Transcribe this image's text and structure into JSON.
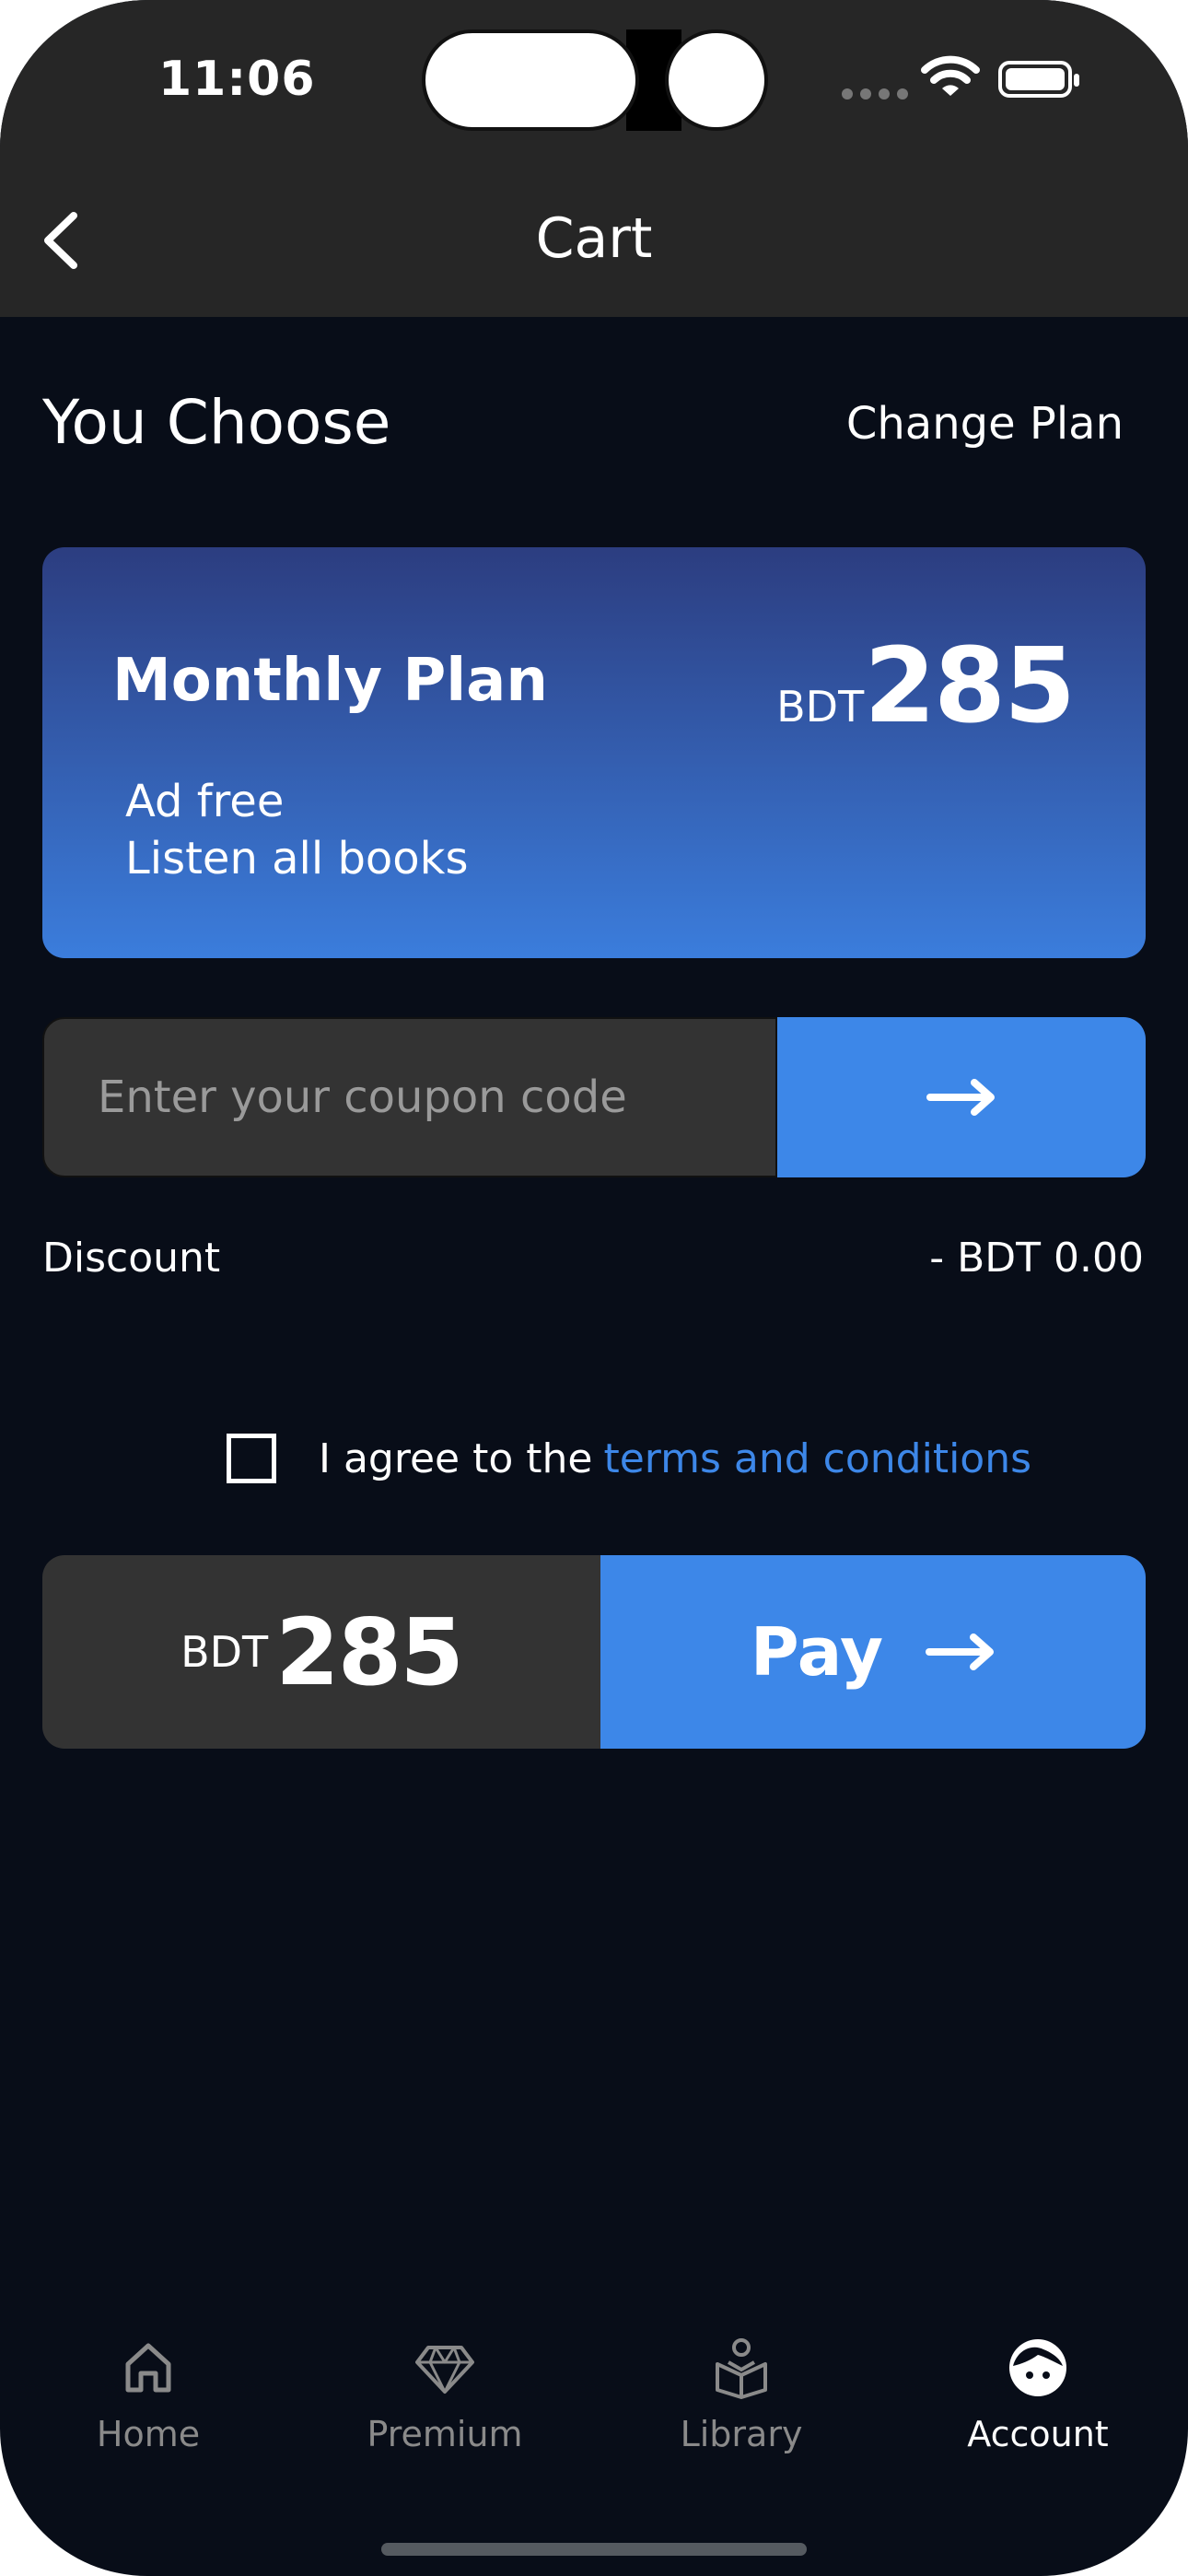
{
  "status_bar": {
    "time": "11:06"
  },
  "nav": {
    "title": "Cart",
    "back_icon": "chevron-left-icon"
  },
  "section": {
    "heading": "You Choose",
    "change_plan": "Change Plan"
  },
  "plan": {
    "name": "Monthly Plan",
    "currency": "BDT",
    "price": "285",
    "features": [
      "Ad free",
      "Listen all books"
    ],
    "gradient": [
      "#2c3d80",
      "#3b7ddc"
    ]
  },
  "coupon": {
    "placeholder": "Enter your coupon code",
    "value": "",
    "submit_icon": "arrow-right-icon"
  },
  "discount": {
    "label": "Discount",
    "value": "- BDT 0.00"
  },
  "terms": {
    "checked": false,
    "text": "I agree to the",
    "link": "terms and conditions"
  },
  "total": {
    "currency": "BDT",
    "amount": "285"
  },
  "pay": {
    "label": "Pay",
    "icon": "arrow-right-icon"
  },
  "tabs": [
    {
      "label": "Home",
      "icon": "home-icon",
      "active": false
    },
    {
      "label": "Premium",
      "icon": "diamond-icon",
      "active": false
    },
    {
      "label": "Library",
      "icon": "library-icon",
      "active": false
    },
    {
      "label": "Account",
      "icon": "account-face-icon",
      "active": true
    }
  ],
  "colors": {
    "accent": "#3d87e8",
    "background": "#080d18",
    "header": "#262626",
    "field": "#333333"
  }
}
